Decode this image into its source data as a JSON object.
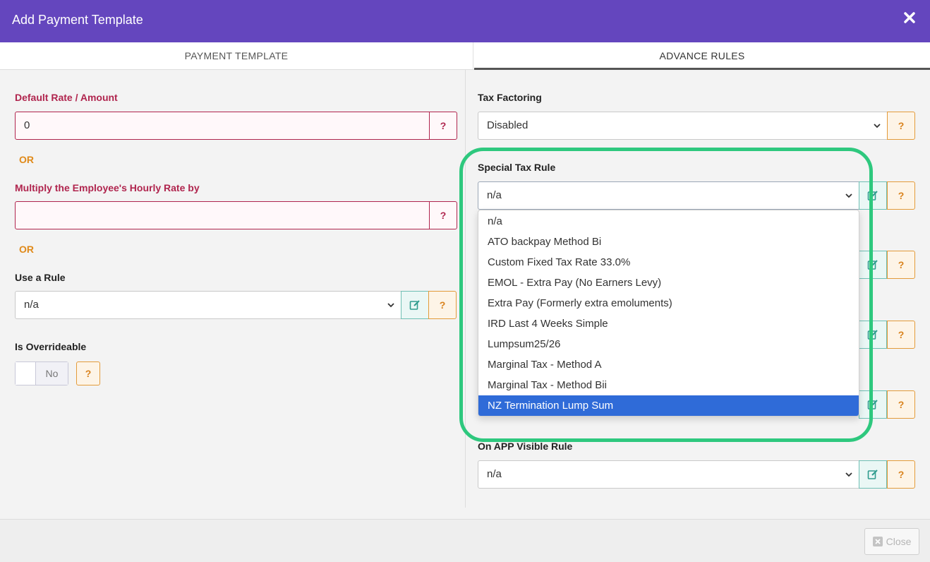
{
  "dialog": {
    "title": "Add Payment Template"
  },
  "tabs": [
    {
      "label": "PAYMENT TEMPLATE"
    },
    {
      "label": "ADVANCE RULES"
    }
  ],
  "left": {
    "default_rate": {
      "label": "Default Rate / Amount",
      "value": "0",
      "help": "?"
    },
    "or1": "OR",
    "multiply": {
      "label": "Multiply the Employee's Hourly Rate by",
      "value": "",
      "help": "?"
    },
    "or2": "OR",
    "use_rule": {
      "label": "Use a Rule",
      "selected": "n/a",
      "help": "?"
    },
    "overrideable": {
      "label": "Is Overrideable",
      "toggle_text": "No",
      "help": "?"
    }
  },
  "right": {
    "tax_factoring": {
      "label": "Tax Factoring",
      "selected": "Disabled",
      "help": "?"
    },
    "special_tax_rule": {
      "label": "Special Tax Rule",
      "selected": "n/a",
      "help": "?",
      "options": [
        "n/a",
        "ATO backpay Method Bi",
        "Custom Fixed Tax Rate 33.0%",
        "EMOL - Extra Pay (No Earners Levy)",
        "Extra Pay (Formerly extra emoluments)",
        "IRD Last 4 Weeks Simple",
        "Lumpsum25/26",
        "Marginal Tax - Method A",
        "Marginal Tax - Method Bii",
        "NZ Termination Lump Sum"
      ],
      "highlighted": "NZ Termination Lump Sum"
    },
    "hidden_help": [
      "?",
      "?",
      "?"
    ],
    "on_app_visible": {
      "label": "On APP Visible Rule",
      "selected": "n/a",
      "help": "?"
    }
  },
  "footer": {
    "close_label": "Close"
  },
  "colors": {
    "header": "#6446be",
    "accent_red": "#b0254e",
    "accent_orange": "#d9821c",
    "teal": "#2f9c8e",
    "highlight_ring": "#2ec87e",
    "selected_option": "#2f6bd8"
  }
}
